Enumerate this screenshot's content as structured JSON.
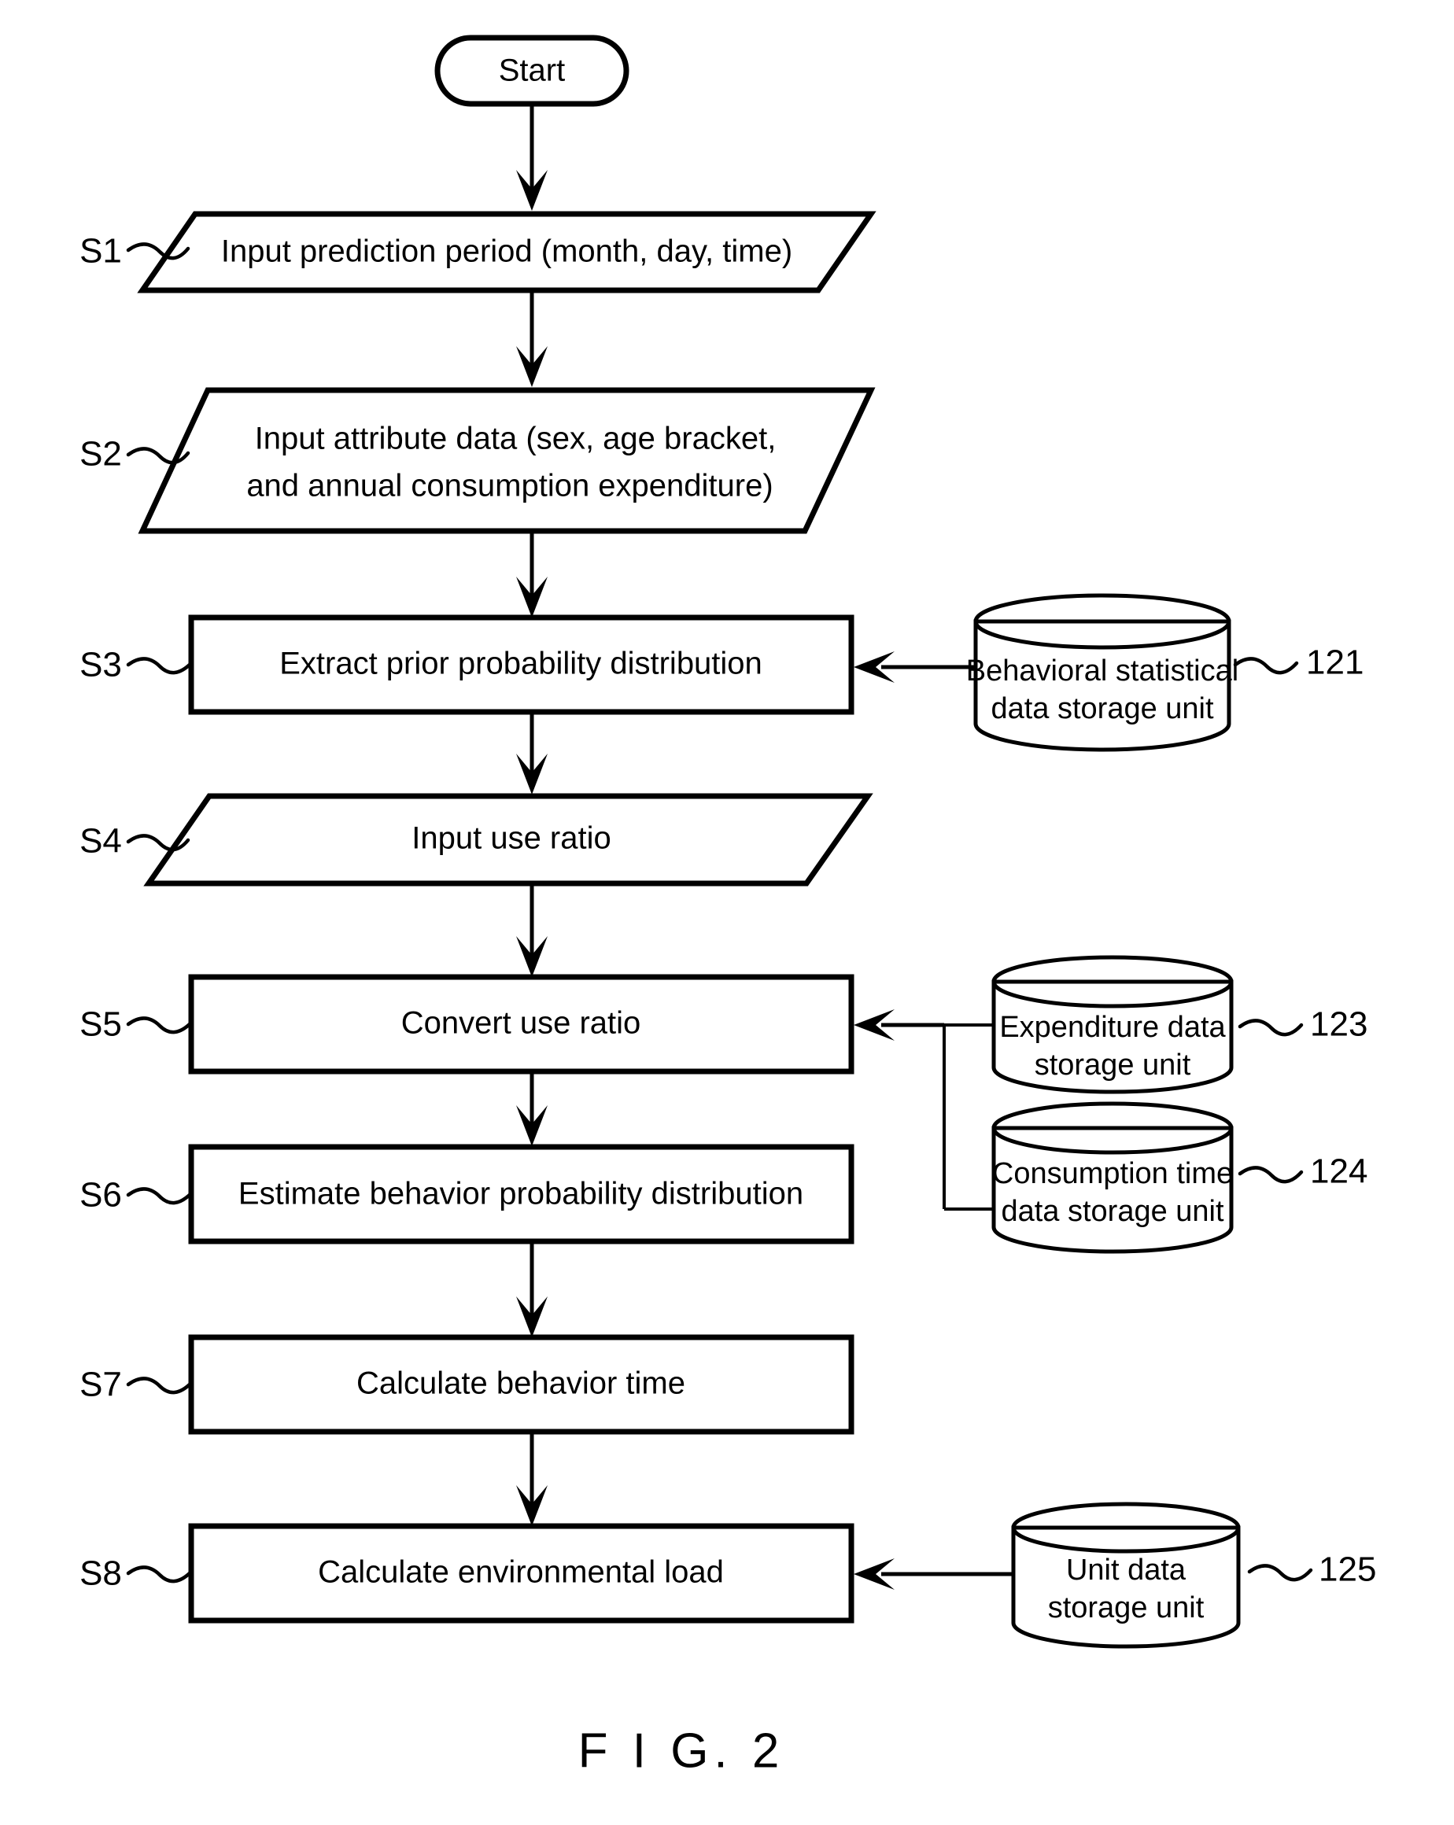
{
  "figure": {
    "caption": "F I G. 2",
    "title_text": "FIG. 2"
  },
  "terminator": {
    "label": "Start"
  },
  "steps": [
    {
      "id": "S1",
      "shape": "parallelogram",
      "lines": [
        "Input prediction period (month, day, time)"
      ]
    },
    {
      "id": "S2",
      "shape": "parallelogram",
      "lines": [
        "Input attribute data (sex, age bracket,",
        "and annual consumption expenditure)"
      ]
    },
    {
      "id": "S3",
      "shape": "rectangle",
      "lines": [
        "Extract prior probability distribution"
      ]
    },
    {
      "id": "S4",
      "shape": "parallelogram",
      "lines": [
        "Input use ratio"
      ]
    },
    {
      "id": "S5",
      "shape": "rectangle",
      "lines": [
        "Convert use ratio"
      ]
    },
    {
      "id": "S6",
      "shape": "rectangle",
      "lines": [
        "Estimate behavior probability distribution"
      ]
    },
    {
      "id": "S7",
      "shape": "rectangle",
      "lines": [
        "Calculate behavior time"
      ]
    },
    {
      "id": "S8",
      "shape": "rectangle",
      "lines": [
        "Calculate environmental load"
      ]
    }
  ],
  "stores": [
    {
      "ref": "121",
      "shape": "cylinder",
      "lines": [
        "Behavioral statistical",
        "data storage unit"
      ]
    },
    {
      "ref": "123",
      "shape": "cylinder",
      "lines": [
        "Expenditure data",
        "storage unit"
      ]
    },
    {
      "ref": "124",
      "shape": "cylinder",
      "lines": [
        "Consumption time",
        "data storage unit"
      ]
    },
    {
      "ref": "125",
      "shape": "cylinder",
      "lines": [
        "Unit data",
        "storage unit"
      ]
    }
  ],
  "colors": {
    "ink": "#000000",
    "paper": "#ffffff"
  }
}
